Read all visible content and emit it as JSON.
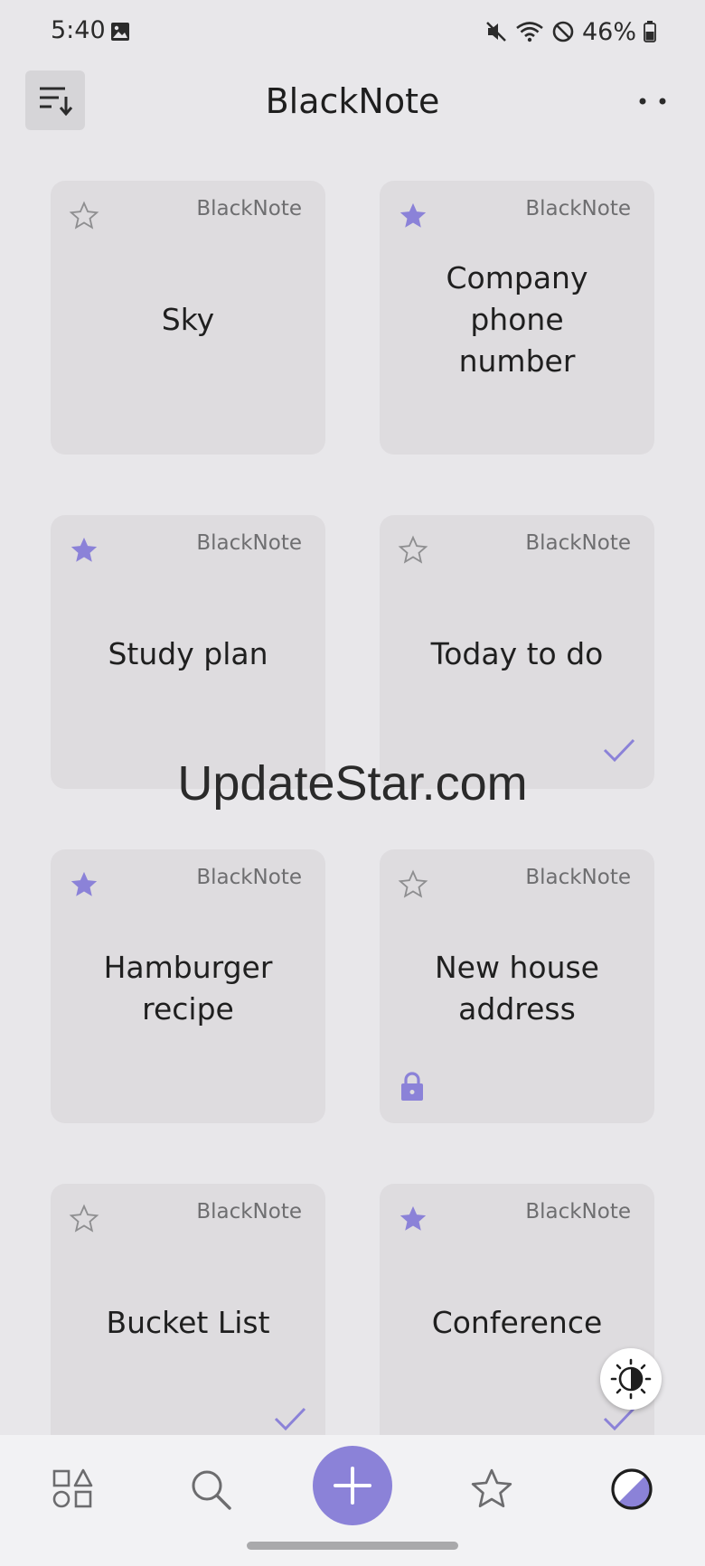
{
  "status_bar": {
    "time": "5:40",
    "battery": "46%",
    "icons": [
      "image-icon",
      "mute-icon",
      "wifi-icon",
      "do-not-disturb-icon",
      "battery-icon"
    ]
  },
  "app_bar": {
    "title": "BlackNote",
    "sort_icon": "sort-icon",
    "more_icon": "more-icon"
  },
  "colors": {
    "accent": "#8b82d8",
    "card_bg": "#dedcdf",
    "page_bg": "#e8e7ea"
  },
  "notes": [
    {
      "title": "Sky",
      "app": "BlackNote",
      "starred": false,
      "badge": ""
    },
    {
      "title": "Company phone number",
      "app": "BlackNote",
      "starred": true,
      "badge": ""
    },
    {
      "title": "Study plan",
      "app": "BlackNote",
      "starred": true,
      "badge": ""
    },
    {
      "title": "Today to do",
      "app": "BlackNote",
      "starred": false,
      "badge": "check"
    },
    {
      "title": "Hamburger recipe",
      "app": "BlackNote",
      "starred": true,
      "badge": ""
    },
    {
      "title": "New house address",
      "app": "BlackNote",
      "starred": false,
      "badge": "lock"
    },
    {
      "title": "Bucket List",
      "app": "BlackNote",
      "starred": false,
      "badge": "check"
    },
    {
      "title": "Conference",
      "app": "BlackNote",
      "starred": true,
      "badge": "check"
    }
  ],
  "watermark": "UpdateStar.com",
  "bottom_nav": {
    "items": [
      "categories-icon",
      "search-icon",
      "add-icon",
      "favorites-icon",
      "theme-icon"
    ]
  }
}
